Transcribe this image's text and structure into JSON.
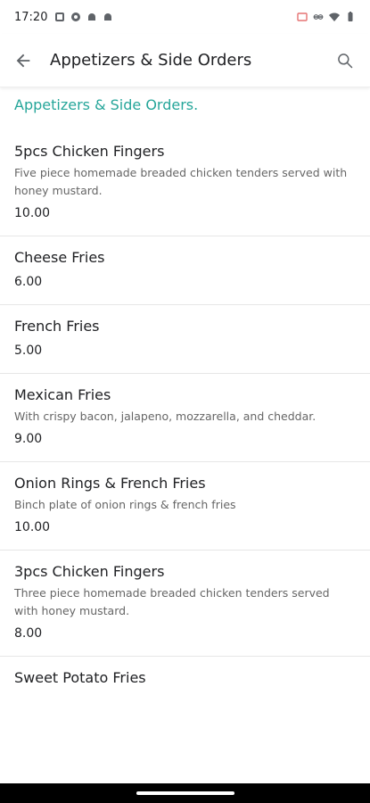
{
  "status_bar": {
    "time": "17:20"
  },
  "app_bar": {
    "title": "Appetizers & Side Orders"
  },
  "section": {
    "heading": "Appetizers & Side Orders."
  },
  "items": [
    {
      "name": "5pcs Chicken Fingers",
      "description": "Five piece homemade breaded chicken tenders served with honey mustard.",
      "price": "10.00"
    },
    {
      "name": "Cheese Fries",
      "description": "",
      "price": "6.00"
    },
    {
      "name": "French Fries",
      "description": "",
      "price": "5.00"
    },
    {
      "name": "Mexican Fries",
      "description": "With crispy bacon, jalapeno, mozzarella, and cheddar.",
      "price": "9.00"
    },
    {
      "name": "Onion Rings & French Fries",
      "description": "Binch plate of onion rings & french fries",
      "price": "10.00"
    },
    {
      "name": "3pcs Chicken Fingers",
      "description": "Three piece homemade breaded chicken tenders served with honey mustard.",
      "price": "8.00"
    },
    {
      "name": "Sweet Potato Fries",
      "description": "",
      "price": ""
    }
  ],
  "colors": {
    "accent": "#26a69a",
    "text_primary": "#202124",
    "text_secondary": "#666666",
    "divider": "#e6e6e6"
  },
  "icons": {
    "back": "arrow-back-icon",
    "search": "search-icon"
  }
}
